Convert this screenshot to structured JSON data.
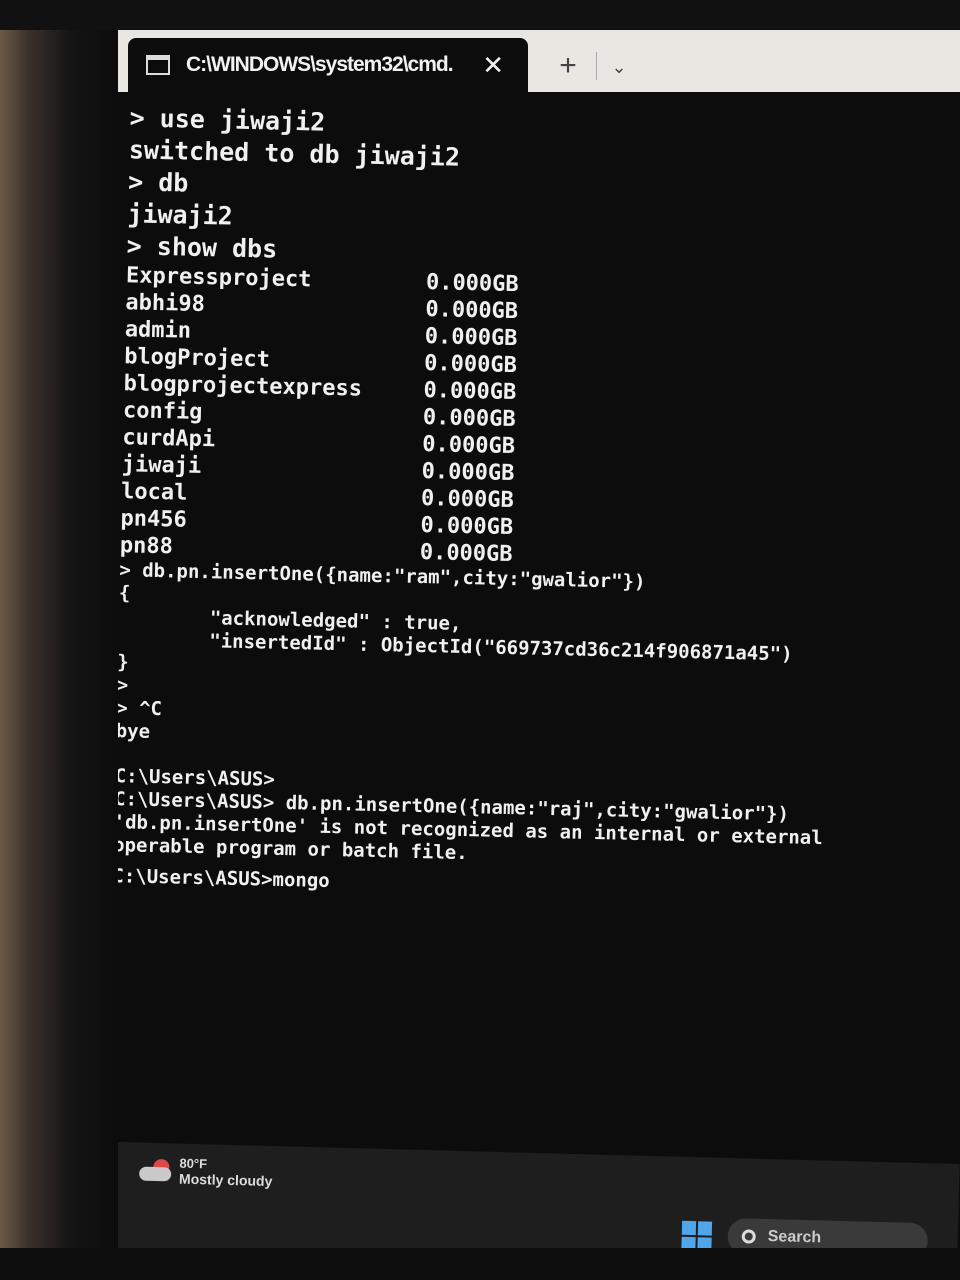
{
  "window": {
    "tab_title": "C:\\WINDOWS\\system32\\cmd.",
    "close_glyph": "✕",
    "new_tab_glyph": "+",
    "dropdown_glyph": "⌄"
  },
  "console": {
    "intro_lines": [
      "> use jiwaji2",
      "switched to db jiwaji2",
      "> db",
      "jiwaji2",
      "> show dbs"
    ],
    "databases": [
      {
        "name": "Expressproject",
        "size": "0.000GB"
      },
      {
        "name": "abhi98",
        "size": "0.000GB"
      },
      {
        "name": "admin",
        "size": "0.000GB"
      },
      {
        "name": "blogProject",
        "size": "0.000GB"
      },
      {
        "name": "blogprojectexpress",
        "size": "0.000GB"
      },
      {
        "name": "config",
        "size": "0.000GB"
      },
      {
        "name": "curdApi",
        "size": "0.000GB"
      },
      {
        "name": "jiwaji",
        "size": "0.000GB"
      },
      {
        "name": "local",
        "size": "0.000GB"
      },
      {
        "name": "pn456",
        "size": "0.000GB"
      },
      {
        "name": "pn88",
        "size": "0.000GB"
      }
    ],
    "insert_lines": [
      "> db.pn.insertOne({name:\"ram\",city:\"gwalior\"})",
      "{",
      "        \"acknowledged\" : true,",
      "        \"insertedId\" : ObjectId(\"669737cd36c214f906871a45\")",
      "}",
      ">",
      "> ^C",
      "bye"
    ],
    "cmd_lines": [
      "C:\\Users\\ASUS>",
      "C:\\Users\\ASUS> db.pn.insertOne({name:\"raj\",city:\"gwalior\"})",
      "'db.pn.insertOne' is not recognized as an internal or external",
      "operable program or batch file."
    ],
    "prompt_line": "C:\\Users\\ASUS>mongo"
  },
  "taskbar": {
    "weather_temp": "80°F",
    "weather_desc": "Mostly cloudy",
    "search_placeholder": "Search",
    "start_color": "#4fa6ea"
  }
}
